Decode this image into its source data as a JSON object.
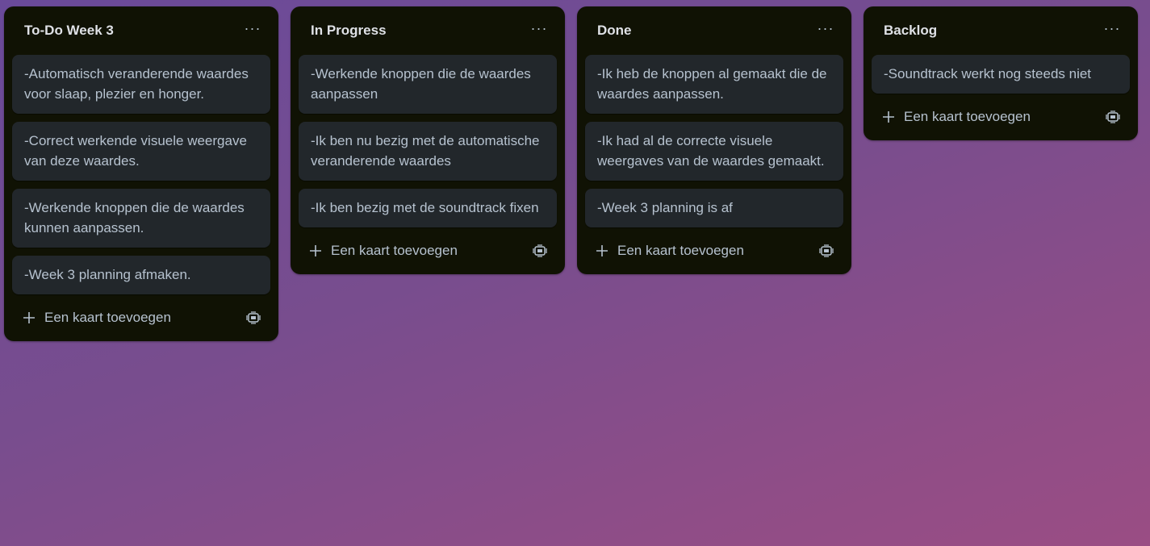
{
  "lists": [
    {
      "title": "To-Do Week 3",
      "cards": [
        "-Automatisch veranderende waardes voor slaap, plezier en honger.",
        "-Correct werkende visuele weergave van deze waardes.",
        "-Werkende knoppen die de waardes kunnen aanpassen.",
        "-Week 3 planning afmaken."
      ],
      "add_card_label": "Een kaart toevoegen"
    },
    {
      "title": "In Progress",
      "cards": [
        "-Werkende knoppen die de waardes aanpassen",
        "-Ik ben nu bezig met de automatische veranderende waardes",
        "-Ik ben bezig met de soundtrack fixen"
      ],
      "add_card_label": "Een kaart toevoegen"
    },
    {
      "title": "Done",
      "cards": [
        "-Ik heb de knoppen al gemaakt die de waardes aanpassen.",
        "-Ik had al de correcte visuele weergaves van de waardes gemaakt.",
        "-Week 3 planning is af"
      ],
      "add_card_label": "Een kaart toevoegen"
    },
    {
      "title": "Backlog",
      "cards": [
        "-Soundtrack werkt nog steeds niet"
      ],
      "add_card_label": "Een kaart toevoegen"
    }
  ],
  "icons": {
    "list_menu": "more-horizontal-icon",
    "add": "plus-icon",
    "template": "card-template-icon"
  },
  "colors": {
    "list_background": "#101204",
    "card_background": "#22272b",
    "text": "#b6c2cf",
    "title_text": "#dfe1e6"
  }
}
